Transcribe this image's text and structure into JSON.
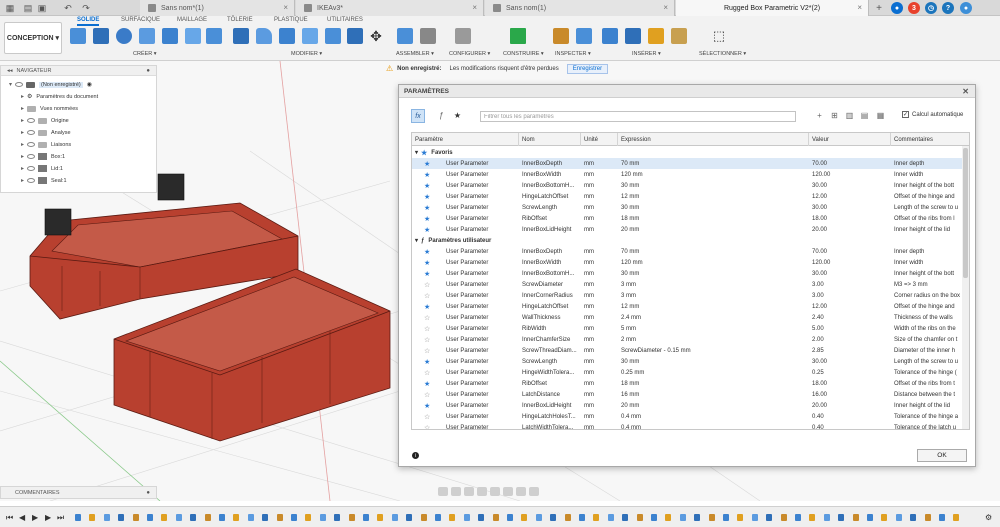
{
  "tabstrip": {
    "tabs": [
      {
        "label": "Sans nom*(1)",
        "active": false
      },
      {
        "label": "IKEAv3*",
        "active": false
      },
      {
        "label": "Sans nom(1)",
        "active": false
      },
      {
        "label": "Rugged Box Parametric V2*(2)",
        "active": true
      }
    ],
    "add_tab": "+",
    "close_glyph": "×",
    "job_badge": "3"
  },
  "ribbon": {
    "workspace": "CONCEPTION ▾",
    "tabs": [
      "SOLIDE",
      "SURFACIQUE",
      "MAILLAGE",
      "TÔLERIE",
      "PLASTIQUE",
      "UTILITAIRES"
    ],
    "groups": [
      "CRÉER ▾",
      "MODIFIER ▾",
      "ASSEMBLER ▾",
      "CONFIGURER ▾",
      "CONSTRUIRE ▾",
      "INSPECTER ▾",
      "INSÉRER ▾",
      "SÉLECTIONNER ▾"
    ]
  },
  "warning": {
    "title": "Non enregistré:",
    "message": "Les modifications risquent d'être perdues",
    "save": "Enregistrer"
  },
  "navigator": {
    "title": "NAVIGATEUR",
    "root": "(Non enregistré)",
    "items": [
      "Paramètres du document",
      "Vues nommées",
      "Origine",
      "Analyse",
      "Liaisons",
      "Box:1",
      "Lid:1",
      "Seal:1"
    ]
  },
  "dialog": {
    "title": "PARAMÈTRES",
    "filter_placeholder": "Filtrer tous les paramètres",
    "auto_calc": "Calcul automatique",
    "ok": "OK",
    "columns": [
      "Paramètre",
      "Nom",
      "Unité",
      "Expression",
      "Valeur",
      "Commentaires"
    ],
    "groups": [
      {
        "label": "Favoris",
        "rows": [
          {
            "fav": true,
            "param": "User Parameter",
            "name": "InnerBoxDepth",
            "unit": "mm",
            "expr": "70 mm",
            "value": "70.00",
            "comment": "Inner depth",
            "selected": true
          },
          {
            "fav": true,
            "param": "User Parameter",
            "name": "InnerBoxWidth",
            "unit": "mm",
            "expr": "120 mm",
            "value": "120.00",
            "comment": "Inner width"
          },
          {
            "fav": true,
            "param": "User Parameter",
            "name": "InnerBoxBottomH...",
            "unit": "mm",
            "expr": "30 mm",
            "value": "30.00",
            "comment": "Inner height of the bott"
          },
          {
            "fav": true,
            "param": "User Parameter",
            "name": "HingeLatchOffset",
            "unit": "mm",
            "expr": "12 mm",
            "value": "12.00",
            "comment": "Offset of the hinge and"
          },
          {
            "fav": true,
            "param": "User Parameter",
            "name": "ScrewLength",
            "unit": "mm",
            "expr": "30 mm",
            "value": "30.00",
            "comment": "Length of the screw to u"
          },
          {
            "fav": true,
            "param": "User Parameter",
            "name": "RibOffset",
            "unit": "mm",
            "expr": "18 mm",
            "value": "18.00",
            "comment": "Offset of the ribs from l"
          },
          {
            "fav": true,
            "param": "User Parameter",
            "name": "InnerBoxLidHeight",
            "unit": "mm",
            "expr": "20 mm",
            "value": "20.00",
            "comment": "Inner height of the lid"
          }
        ]
      },
      {
        "label": "Paramètres utilisateur",
        "rows": [
          {
            "fav": true,
            "param": "User Parameter",
            "name": "InnerBoxDepth",
            "unit": "mm",
            "expr": "70 mm",
            "value": "70.00",
            "comment": "Inner depth"
          },
          {
            "fav": true,
            "param": "User Parameter",
            "name": "InnerBoxWidth",
            "unit": "mm",
            "expr": "120 mm",
            "value": "120.00",
            "comment": "Inner width"
          },
          {
            "fav": true,
            "param": "User Parameter",
            "name": "InnerBoxBottomH...",
            "unit": "mm",
            "expr": "30 mm",
            "value": "30.00",
            "comment": "Inner height of the bott"
          },
          {
            "fav": false,
            "param": "User Parameter",
            "name": "ScrewDiameter",
            "unit": "mm",
            "expr": "3 mm",
            "value": "3.00",
            "comment": "M3 => 3 mm"
          },
          {
            "fav": false,
            "param": "User Parameter",
            "name": "InnerCornerRadius",
            "unit": "mm",
            "expr": "3 mm",
            "value": "3.00",
            "comment": "Corner radius on the box"
          },
          {
            "fav": true,
            "param": "User Parameter",
            "name": "HingeLatchOffset",
            "unit": "mm",
            "expr": "12 mm",
            "value": "12.00",
            "comment": "Offset of the hinge and"
          },
          {
            "fav": false,
            "param": "User Parameter",
            "name": "WallThickness",
            "unit": "mm",
            "expr": "2.4 mm",
            "value": "2.40",
            "comment": "Thickness of the walls"
          },
          {
            "fav": false,
            "param": "User Parameter",
            "name": "RibWidth",
            "unit": "mm",
            "expr": "5 mm",
            "value": "5.00",
            "comment": "Width of the ribs on the"
          },
          {
            "fav": false,
            "param": "User Parameter",
            "name": "InnerChamferSize",
            "unit": "mm",
            "expr": "2 mm",
            "value": "2.00",
            "comment": "Size of the chamfer on t"
          },
          {
            "fav": false,
            "param": "User Parameter",
            "name": "ScrewThreadDiam...",
            "unit": "mm",
            "expr": "ScrewDiameter - 0.15 mm",
            "value": "2.85",
            "comment": "Diameter of the inner h"
          },
          {
            "fav": true,
            "param": "User Parameter",
            "name": "ScrewLength",
            "unit": "mm",
            "expr": "30 mm",
            "value": "30.00",
            "comment": "Length of the screw to u"
          },
          {
            "fav": false,
            "param": "User Parameter",
            "name": "HingeWidthTolera...",
            "unit": "mm",
            "expr": "0.25 mm",
            "value": "0.25",
            "comment": "Tolerance of the hinge ("
          },
          {
            "fav": true,
            "param": "User Parameter",
            "name": "RibOffset",
            "unit": "mm",
            "expr": "18 mm",
            "value": "18.00",
            "comment": "Offset of the ribs from t"
          },
          {
            "fav": false,
            "param": "User Parameter",
            "name": "LatchDistance",
            "unit": "mm",
            "expr": "16 mm",
            "value": "16.00",
            "comment": "Distance between the t"
          },
          {
            "fav": true,
            "param": "User Parameter",
            "name": "InnerBoxLidHeight",
            "unit": "mm",
            "expr": "20 mm",
            "value": "20.00",
            "comment": "Inner height of the lid"
          },
          {
            "fav": false,
            "param": "User Parameter",
            "name": "HingeLatchHolesT...",
            "unit": "mm",
            "expr": "0.4 mm",
            "value": "0.40",
            "comment": "Tolerance of the hinge a"
          },
          {
            "fav": false,
            "param": "User Parameter",
            "name": "LatchWidthTolera...",
            "unit": "mm",
            "expr": "0.4 mm",
            "value": "0.40",
            "comment": "Tolerance of the latch u"
          }
        ]
      }
    ]
  },
  "bottom": {
    "comments": "COMMENTAIRES"
  },
  "colors": {
    "accent": "#0a6ed1",
    "model_red": "#b8402f",
    "latch_black": "#2a2a2a",
    "star_blue": "#2a7bd4"
  }
}
